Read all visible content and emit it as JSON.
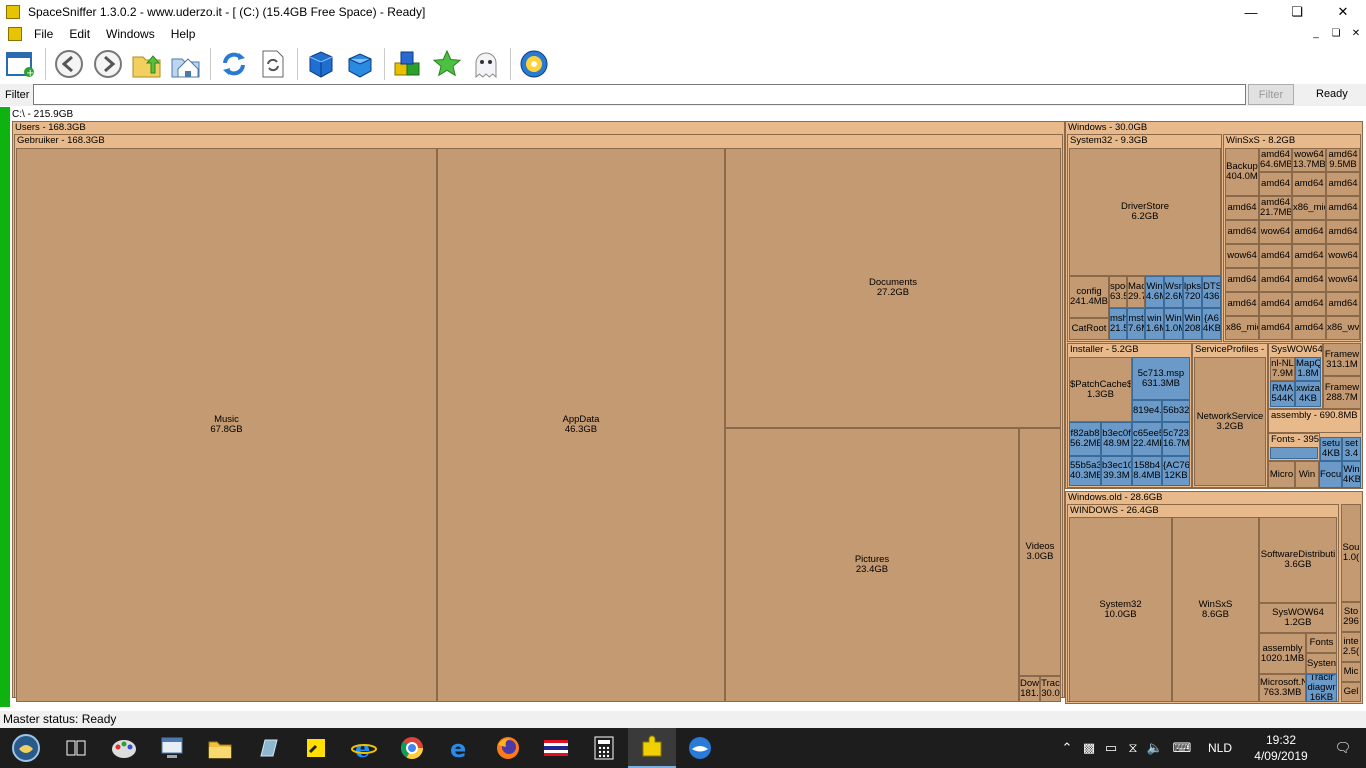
{
  "window": {
    "title": "SpaceSniffer 1.3.0.2 - www.uderzo.it - [ (C:) (15.4GB Free Space) - Ready]"
  },
  "menu": [
    "File",
    "Edit",
    "Windows",
    "Help"
  ],
  "filter": {
    "label": "Filter",
    "value": "",
    "button": "Filter",
    "state": "Ready"
  },
  "root_label": "C:\\ - 215.9GB",
  "treemap": [
    {
      "n": "users",
      "l": "Users - 168.3GB",
      "k": "c",
      "h": 1,
      "r": [
        12,
        121,
        1053,
        577
      ]
    },
    {
      "n": "gebruiker",
      "l": "Gebruiker - 168.3GB",
      "k": "c",
      "h": 1,
      "r": [
        14,
        134,
        1049,
        564
      ]
    },
    {
      "n": "music",
      "l": "Music\n67.8GB",
      "k": "f",
      "r": [
        16,
        148,
        421,
        554
      ]
    },
    {
      "n": "appdata",
      "l": "AppData\n46.3GB",
      "k": "f",
      "r": [
        437,
        148,
        288,
        554
      ]
    },
    {
      "n": "documents",
      "l": "Documents\n27.2GB",
      "k": "f",
      "r": [
        725,
        148,
        336,
        280
      ]
    },
    {
      "n": "pictures",
      "l": "Pictures\n23.4GB",
      "k": "f",
      "r": [
        725,
        428,
        294,
        274
      ]
    },
    {
      "n": "videos",
      "l": "Videos\n3.0GB",
      "k": "f",
      "r": [
        1019,
        428,
        42,
        248
      ]
    },
    {
      "n": "downloads",
      "l": "Dow\n181.",
      "k": "f",
      "r": [
        1019,
        676,
        21,
        26
      ]
    },
    {
      "n": "tracing",
      "l": "Trac\n30.0",
      "k": "f",
      "r": [
        1040,
        676,
        21,
        26
      ]
    },
    {
      "n": "windows",
      "l": "Windows - 30.0GB",
      "k": "c",
      "h": 1,
      "r": [
        1065,
        121,
        298,
        368
      ]
    },
    {
      "n": "system32",
      "l": "System32 - 9.3GB",
      "k": "c",
      "h": 1,
      "r": [
        1067,
        134,
        155,
        208
      ]
    },
    {
      "n": "driverstore",
      "l": "DriverStore\n6.2GB",
      "k": "f",
      "r": [
        1069,
        148,
        152,
        128
      ]
    },
    {
      "n": "config",
      "l": "config\n241.4MB",
      "k": "f",
      "r": [
        1069,
        276,
        40,
        42
      ]
    },
    {
      "n": "catroot",
      "l": "CatRoot",
      "k": "f",
      "r": [
        1069,
        318,
        40,
        22
      ]
    },
    {
      "n": "spool",
      "l": "spoo\n63.5",
      "k": "f",
      "r": [
        1109,
        276,
        18,
        32
      ]
    },
    {
      "n": "mac",
      "l": "Mac\n29.7",
      "k": "f",
      "r": [
        1127,
        276,
        18,
        32
      ]
    },
    {
      "n": "msh",
      "l": "msh\n21.5",
      "k": "b",
      "r": [
        1109,
        308,
        18,
        32
      ]
    },
    {
      "n": "mst",
      "l": "mst\n7.6M",
      "k": "b",
      "r": [
        1127,
        308,
        18,
        32
      ]
    },
    {
      "n": "win-a",
      "l": "Win\n4.6M",
      "k": "b",
      "r": [
        1145,
        276,
        19,
        32
      ]
    },
    {
      "n": "wsn",
      "l": "Wsn\n2.6M",
      "k": "b",
      "r": [
        1164,
        276,
        19,
        32
      ]
    },
    {
      "n": "lpks",
      "l": "lpks\n720",
      "k": "b",
      "r": [
        1183,
        276,
        19,
        32
      ]
    },
    {
      "n": "dts",
      "l": "DTS\n436",
      "k": "b",
      "r": [
        1202,
        276,
        19,
        32
      ]
    },
    {
      "n": "win-b",
      "l": "win\n1.6M",
      "k": "b",
      "r": [
        1145,
        308,
        19,
        32
      ]
    },
    {
      "n": "win-c",
      "l": "Win\n1.0M",
      "k": "b",
      "r": [
        1164,
        308,
        19,
        32
      ]
    },
    {
      "n": "win-d",
      "l": "Win\n208",
      "k": "b",
      "r": [
        1183,
        308,
        19,
        32
      ]
    },
    {
      "n": "a6",
      "l": "{A6\n4KB",
      "k": "b",
      "r": [
        1202,
        308,
        19,
        32
      ]
    },
    {
      "n": "winsxs-a",
      "l": "WinSxS - 8.2GB",
      "k": "c",
      "h": 1,
      "r": [
        1223,
        134,
        138,
        208
      ]
    },
    {
      "n": "backup",
      "l": "Backup\n404.0M",
      "k": "f",
      "r": [
        1225,
        148,
        34,
        48
      ]
    },
    {
      "n": "amd64-1",
      "l": "amd64\n64.6MB",
      "k": "f",
      "r": [
        1259,
        148,
        33,
        24
      ]
    },
    {
      "n": "wow64-1",
      "l": "wow64\n13.7MB",
      "k": "f",
      "r": [
        1292,
        148,
        34,
        24
      ]
    },
    {
      "n": "amd64-2",
      "l": "amd64\n9.5MB",
      "k": "f",
      "r": [
        1326,
        148,
        34,
        24
      ]
    },
    {
      "n": "amd64-3",
      "l": "amd64",
      "k": "f",
      "r": [
        1259,
        172,
        33,
        24
      ]
    },
    {
      "n": "amd64-4",
      "l": "amd64",
      "k": "f",
      "r": [
        1292,
        172,
        34,
        24
      ]
    },
    {
      "n": "amd64-5",
      "l": "amd64",
      "k": "f",
      "r": [
        1326,
        172,
        34,
        24
      ]
    },
    {
      "n": "amd64-6",
      "l": "amd64",
      "k": "f",
      "r": [
        1225,
        196,
        34,
        24
      ]
    },
    {
      "n": "amd64-7",
      "l": "amd64\n21.7MB",
      "k": "f",
      "r": [
        1259,
        196,
        33,
        24
      ]
    },
    {
      "n": "x86-1",
      "l": "x86_mic",
      "k": "f",
      "r": [
        1292,
        196,
        34,
        24
      ]
    },
    {
      "n": "amd64-8",
      "l": "amd64",
      "k": "f",
      "r": [
        1326,
        196,
        34,
        24
      ]
    },
    {
      "n": "amd64-9",
      "l": "amd64",
      "k": "f",
      "r": [
        1225,
        220,
        34,
        24
      ]
    },
    {
      "n": "wow64-2",
      "l": "wow64",
      "k": "f",
      "r": [
        1259,
        220,
        33,
        24
      ]
    },
    {
      "n": "amd64-10",
      "l": "amd64",
      "k": "f",
      "r": [
        1292,
        220,
        34,
        24
      ]
    },
    {
      "n": "amd64-11",
      "l": "amd64",
      "k": "f",
      "r": [
        1326,
        220,
        34,
        24
      ]
    },
    {
      "n": "wow64-3",
      "l": "wow64",
      "k": "f",
      "r": [
        1225,
        244,
        34,
        24
      ]
    },
    {
      "n": "amd64-12",
      "l": "amd64",
      "k": "f",
      "r": [
        1259,
        244,
        33,
        24
      ]
    },
    {
      "n": "amd64-13",
      "l": "amd64",
      "k": "f",
      "r": [
        1292,
        244,
        34,
        24
      ]
    },
    {
      "n": "wow64-4",
      "l": "wow64",
      "k": "f",
      "r": [
        1326,
        244,
        34,
        24
      ]
    },
    {
      "n": "amd64-14",
      "l": "amd64",
      "k": "f",
      "r": [
        1225,
        268,
        34,
        24
      ]
    },
    {
      "n": "amd64-15",
      "l": "amd64",
      "k": "f",
      "r": [
        1259,
        268,
        33,
        24
      ]
    },
    {
      "n": "amd64-16",
      "l": "amd64",
      "k": "f",
      "r": [
        1292,
        268,
        34,
        24
      ]
    },
    {
      "n": "wow64-5",
      "l": "wow64",
      "k": "f",
      "r": [
        1326,
        268,
        34,
        24
      ]
    },
    {
      "n": "amd64-17",
      "l": "amd64",
      "k": "f",
      "r": [
        1225,
        292,
        34,
        24
      ]
    },
    {
      "n": "amd64-18",
      "l": "amd64",
      "k": "f",
      "r": [
        1259,
        292,
        33,
        24
      ]
    },
    {
      "n": "amd64-19",
      "l": "amd64",
      "k": "f",
      "r": [
        1292,
        292,
        34,
        24
      ]
    },
    {
      "n": "amd64-20",
      "l": "amd64",
      "k": "f",
      "r": [
        1326,
        292,
        34,
        24
      ]
    },
    {
      "n": "x86-2",
      "l": "x86_mic",
      "k": "f",
      "r": [
        1225,
        316,
        34,
        24
      ]
    },
    {
      "n": "amd64-21",
      "l": "amd64",
      "k": "f",
      "r": [
        1259,
        316,
        33,
        24
      ]
    },
    {
      "n": "amd64-22",
      "l": "amd64",
      "k": "f",
      "r": [
        1292,
        316,
        34,
        24
      ]
    },
    {
      "n": "x86-3",
      "l": "x86_wv",
      "k": "f",
      "r": [
        1326,
        316,
        34,
        24
      ]
    },
    {
      "n": "installer",
      "l": "Installer - 5.2GB",
      "k": "c",
      "h": 1,
      "r": [
        1067,
        343,
        125,
        145
      ]
    },
    {
      "n": "patchcache",
      "l": "$PatchCache$\n1.3GB",
      "k": "f",
      "r": [
        1069,
        357,
        63,
        65
      ]
    },
    {
      "n": "5c713",
      "l": "5c713.msp\n631.3MB",
      "k": "b",
      "r": [
        1132,
        357,
        58,
        43
      ]
    },
    {
      "n": "819e4",
      "l": "819e4.",
      "k": "b",
      "r": [
        1132,
        400,
        30,
        22
      ]
    },
    {
      "n": "56b32",
      "l": "56b32",
      "k": "b",
      "r": [
        1162,
        400,
        28,
        22
      ]
    },
    {
      "n": "f82ab8",
      "l": "f82ab8\n56.2MB",
      "k": "b",
      "r": [
        1069,
        422,
        32,
        34
      ]
    },
    {
      "n": "b3ec0f",
      "l": "b3ec0f\n48.9M",
      "k": "b",
      "r": [
        1101,
        422,
        31,
        34
      ]
    },
    {
      "n": "c65ee5",
      "l": "c65ee5\n22.4MB",
      "k": "b",
      "r": [
        1132,
        422,
        30,
        34
      ]
    },
    {
      "n": "5c723",
      "l": "5c723\n16.7M",
      "k": "b",
      "r": [
        1162,
        422,
        28,
        34
      ]
    },
    {
      "n": "55b5a3",
      "l": "55b5a3\n40.3MB",
      "k": "b",
      "r": [
        1069,
        456,
        32,
        30
      ]
    },
    {
      "n": "b3ec10",
      "l": "b3ec10\n39.3M",
      "k": "b",
      "r": [
        1101,
        456,
        31,
        30
      ]
    },
    {
      "n": "158b4",
      "l": "158b4\n8.4MB",
      "k": "b",
      "r": [
        1132,
        456,
        30,
        30
      ]
    },
    {
      "n": "ac76",
      "l": "{AC76\n12KB",
      "k": "b",
      "r": [
        1162,
        456,
        28,
        30
      ]
    },
    {
      "n": "serviceprofiles",
      "l": "ServiceProfiles - 3",
      "k": "c",
      "h": 1,
      "r": [
        1192,
        343,
        76,
        145
      ]
    },
    {
      "n": "networkservice",
      "l": "NetworkService\n3.2GB",
      "k": "f",
      "r": [
        1194,
        357,
        72,
        129
      ]
    },
    {
      "n": "syswow64-a",
      "l": "SysWOW64",
      "k": "c",
      "h": 1,
      "r": [
        1268,
        343,
        55,
        66
      ]
    },
    {
      "n": "nl-nl",
      "l": "nl-NL\n7.9M",
      "k": "f",
      "r": [
        1270,
        357,
        25,
        24
      ]
    },
    {
      "n": "mapq",
      "l": "MapQ\n1.8M",
      "k": "b",
      "r": [
        1295,
        357,
        26,
        24
      ]
    },
    {
      "n": "rma",
      "l": "RMA\n544K",
      "k": "b",
      "r": [
        1270,
        381,
        25,
        26
      ]
    },
    {
      "n": "xwiza",
      "l": "xwiza\n4KB",
      "k": "b",
      "r": [
        1295,
        381,
        26,
        26
      ]
    },
    {
      "n": "framew-1",
      "l": "Framew\n313.1M",
      "k": "f",
      "r": [
        1323,
        343,
        38,
        33
      ]
    },
    {
      "n": "framew-2",
      "l": "Framew\n288.7M",
      "k": "f",
      "r": [
        1323,
        376,
        38,
        33
      ]
    },
    {
      "n": "assembly-a",
      "l": "assembly - 690.8MB",
      "k": "c",
      "h": 1,
      "r": [
        1268,
        409,
        93,
        24
      ]
    },
    {
      "n": "fonts-a",
      "l": "Fonts - 395",
      "k": "c",
      "h": 1,
      "r": [
        1268,
        433,
        52,
        28
      ]
    },
    {
      "n": "fonts-a-blue",
      "l": "",
      "k": "b",
      "r": [
        1270,
        447,
        48,
        12
      ]
    },
    {
      "n": "setup-a",
      "l": "setu\n4KB",
      "k": "b",
      "r": [
        1320,
        437,
        22,
        24
      ]
    },
    {
      "n": "setup-b",
      "l": "set\n3.4",
      "k": "b",
      "r": [
        1342,
        437,
        19,
        24
      ]
    },
    {
      "n": "micro-a",
      "l": "Micro",
      "k": "f",
      "r": [
        1268,
        461,
        27,
        27
      ]
    },
    {
      "n": "win-e",
      "l": "Win",
      "k": "f",
      "r": [
        1295,
        461,
        24,
        27
      ]
    },
    {
      "n": "focus",
      "l": "Focu",
      "k": "b",
      "r": [
        1319,
        461,
        23,
        27
      ]
    },
    {
      "n": "win-f",
      "l": "Win\n4KB",
      "k": "b",
      "r": [
        1342,
        461,
        19,
        27
      ]
    },
    {
      "n": "windows-old",
      "l": "Windows.old - 28.6GB",
      "k": "c",
      "h": 1,
      "r": [
        1065,
        491,
        298,
        213
      ]
    },
    {
      "n": "windows-inner",
      "l": "WINDOWS - 26.4GB",
      "k": "c",
      "h": 1,
      "r": [
        1067,
        504,
        272,
        198
      ]
    },
    {
      "n": "system32-old",
      "l": "System32\n10.0GB",
      "k": "f",
      "r": [
        1069,
        517,
        103,
        185
      ]
    },
    {
      "n": "winsxs-old",
      "l": "WinSxS\n8.6GB",
      "k": "f",
      "r": [
        1172,
        517,
        87,
        185
      ]
    },
    {
      "n": "softwaredistribution",
      "l": "SoftwareDistributi\n3.6GB",
      "k": "f",
      "r": [
        1259,
        517,
        78,
        86
      ]
    },
    {
      "n": "syswow64-old",
      "l": "SysWOW64\n1.2GB",
      "k": "f",
      "r": [
        1259,
        603,
        78,
        30
      ]
    },
    {
      "n": "assembly-old",
      "l": "assembly\n1020.1MB",
      "k": "f",
      "r": [
        1259,
        633,
        47,
        41
      ]
    },
    {
      "n": "fonts-old",
      "l": "Fonts",
      "k": "f",
      "r": [
        1306,
        633,
        31,
        20
      ]
    },
    {
      "n": "system-old",
      "l": "Systen",
      "k": "f",
      "r": [
        1306,
        653,
        31,
        21
      ]
    },
    {
      "n": "microsoftn",
      "l": "Microsoft.N\n763.3MB",
      "k": "f",
      "r": [
        1259,
        674,
        47,
        28
      ]
    },
    {
      "n": "diagwr",
      "l": "Tracir\ndiagwr\n16KB",
      "k": "b",
      "r": [
        1306,
        674,
        31,
        28
      ]
    },
    {
      "n": "sou",
      "l": "Sou\n1.0(",
      "k": "f",
      "r": [
        1341,
        504,
        20,
        98
      ]
    },
    {
      "n": "sto",
      "l": "Sto\n296",
      "k": "f",
      "r": [
        1341,
        602,
        20,
        30
      ]
    },
    {
      "n": "inte",
      "l": "inte\n2.5(",
      "k": "f",
      "r": [
        1341,
        632,
        20,
        30
      ]
    },
    {
      "n": "mic-old",
      "l": "Mic",
      "k": "f",
      "r": [
        1341,
        662,
        20,
        20
      ]
    },
    {
      "n": "gel",
      "l": "Gel",
      "k": "f",
      "r": [
        1341,
        682,
        20,
        20
      ]
    }
  ],
  "status": "Master status: Ready",
  "tray": {
    "lang": "NLD",
    "time": "19:32",
    "date": "4/09/2019"
  }
}
